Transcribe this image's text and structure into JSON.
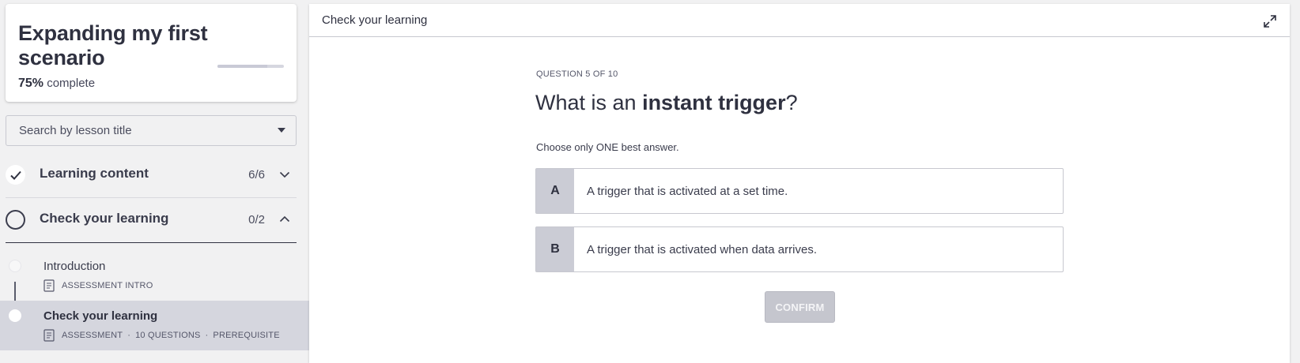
{
  "course": {
    "title": "Expanding my first scenario",
    "progress_percent": "75%",
    "progress_suffix": "complete",
    "progress_fraction": 0.75
  },
  "search": {
    "placeholder": "Search by lesson title"
  },
  "sections": [
    {
      "title": "Learning content",
      "count": "6/6",
      "status": "complete",
      "expanded": false
    },
    {
      "title": "Check your learning",
      "count": "0/2",
      "status": "incomplete",
      "expanded": true
    }
  ],
  "lessons": [
    {
      "title": "Introduction",
      "meta": [
        "ASSESSMENT INTRO"
      ],
      "active": false
    },
    {
      "title": "Check your learning",
      "meta": [
        "ASSESSMENT",
        "10 QUESTIONS",
        "PREREQUISITE"
      ],
      "meta_separator": "·",
      "active": true
    }
  ],
  "main": {
    "header_title": "Check your learning",
    "question_number": "QUESTION 5 OF 10",
    "question_prefix": "What is an ",
    "question_emphasis": "instant trigger",
    "question_suffix": "?",
    "instructions": "Choose only ONE best answer.",
    "options": [
      {
        "letter": "A",
        "text": "A trigger that is activated at a set time."
      },
      {
        "letter": "B",
        "text": "A trigger that is activated when data arrives."
      }
    ],
    "confirm_label": "CONFIRM"
  },
  "icons": {
    "check": "check-icon",
    "chevron_down": "chevron-down-icon",
    "chevron_up": "chevron-up-icon",
    "expand": "expand-icon",
    "document": "document-icon"
  },
  "colors": {
    "text_dark": "#2f3140",
    "option_letter_bg": "#cbccd5",
    "confirm_disabled_bg": "#c5c6ce",
    "active_lesson_bg": "#d5d6de"
  }
}
